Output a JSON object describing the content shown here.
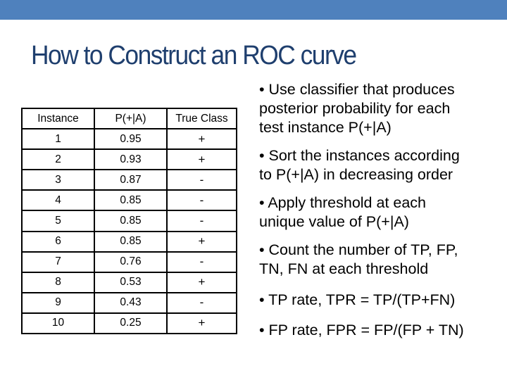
{
  "slide": {
    "title": "How to Construct an ROC curve",
    "accent_color": "#4f81bd"
  },
  "table": {
    "headers": [
      "Instance",
      "P(+|A)",
      "True Class"
    ],
    "rows": [
      [
        "1",
        "0.95",
        "+"
      ],
      [
        "2",
        "0.93",
        "+"
      ],
      [
        "3",
        "0.87",
        "-"
      ],
      [
        "4",
        "0.85",
        "-"
      ],
      [
        "5",
        "0.85",
        "-"
      ],
      [
        "6",
        "0.85",
        "+"
      ],
      [
        "7",
        "0.76",
        "-"
      ],
      [
        "8",
        "0.53",
        "+"
      ],
      [
        "9",
        "0.43",
        "-"
      ],
      [
        "10",
        "0.25",
        "+"
      ]
    ]
  },
  "bullets": [
    "• Use classifier that produces\nposterior probability for each\ntest instance P(+|A)",
    "• Sort the instances according\nto P(+|A) in decreasing order",
    "• Apply threshold at each\nunique value of P(+|A)",
    "• Count the number of TP, FP,\n  TN, FN at each threshold",
    "• TP rate, TPR = TP/(TP+FN)",
    "• FP rate, FPR = FP/(FP + TN)"
  ]
}
